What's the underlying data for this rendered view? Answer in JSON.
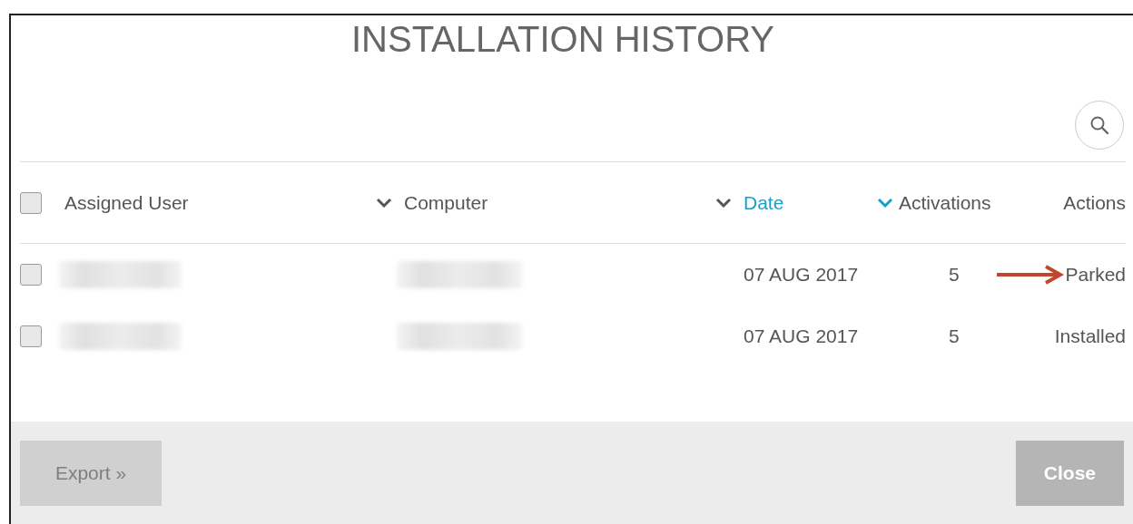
{
  "dialog": {
    "title": "INSTALLATION HISTORY"
  },
  "table": {
    "select_all": {
      "checked": false
    },
    "columns": [
      {
        "label": "Assigned User",
        "sortable": true,
        "selected": false
      },
      {
        "label": "Computer",
        "sortable": true,
        "selected": false
      },
      {
        "label": "Date",
        "sortable": true,
        "selected": true
      },
      {
        "label": "Activations",
        "sortable": false,
        "selected": false
      },
      {
        "label": "Actions",
        "sortable": false,
        "selected": false
      }
    ],
    "rows": [
      {
        "checked": false,
        "date": "07 AUG 2017",
        "activations": "5",
        "action": "Parked",
        "arrow": true
      },
      {
        "checked": false,
        "date": "07 AUG 2017",
        "activations": "5",
        "action": "Installed",
        "arrow": false
      }
    ]
  },
  "footer": {
    "buttons": [
      {
        "label": "Export »",
        "disabled": true
      },
      {
        "label": "Close",
        "disabled": false
      }
    ]
  }
}
